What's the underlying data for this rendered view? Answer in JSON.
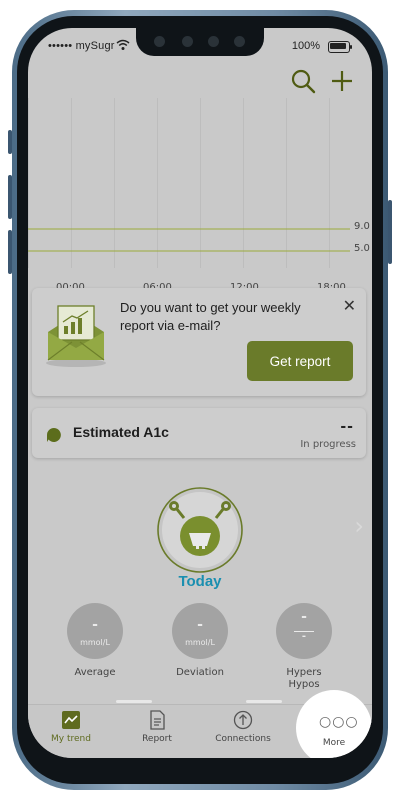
{
  "status_bar": {
    "carrier": "•••••• mySugr",
    "battery_pct": "100%"
  },
  "header": {
    "search_icon": "search-icon",
    "add_icon": "plus-icon"
  },
  "chart": {
    "y_reference_labels": [
      "9.0",
      "5.0"
    ],
    "x_tick_labels": [
      "00:00",
      "06:00",
      "12:00",
      "18:00"
    ],
    "reference_line_color": "#9aaa3c"
  },
  "report_card": {
    "message": "Do you want to get your weekly report via e-mail?",
    "button_label": "Get report",
    "button_color": "#6a7b2a"
  },
  "a1c_card": {
    "title": "Estimated A1c",
    "value": "--",
    "status": "In progress"
  },
  "today": {
    "label": "Today",
    "label_color": "#1a8fb0"
  },
  "stats": [
    {
      "value": "-",
      "unit": "mmol/L",
      "label": "Average"
    },
    {
      "value": "-",
      "unit": "mmol/L",
      "label": "Deviation"
    },
    {
      "value": "-",
      "value2": "-",
      "label": "Hypers",
      "label2": "Hypos"
    }
  ],
  "tabbar": {
    "tabs": [
      {
        "label": "My trend",
        "icon": "trend-icon",
        "active": true
      },
      {
        "label": "Report",
        "icon": "report-icon",
        "active": false
      },
      {
        "label": "Connections",
        "icon": "connections-icon",
        "active": false
      },
      {
        "label": "More",
        "icon": "more-dots-icon",
        "active": false
      }
    ],
    "active_color": "#5f6b1f"
  }
}
